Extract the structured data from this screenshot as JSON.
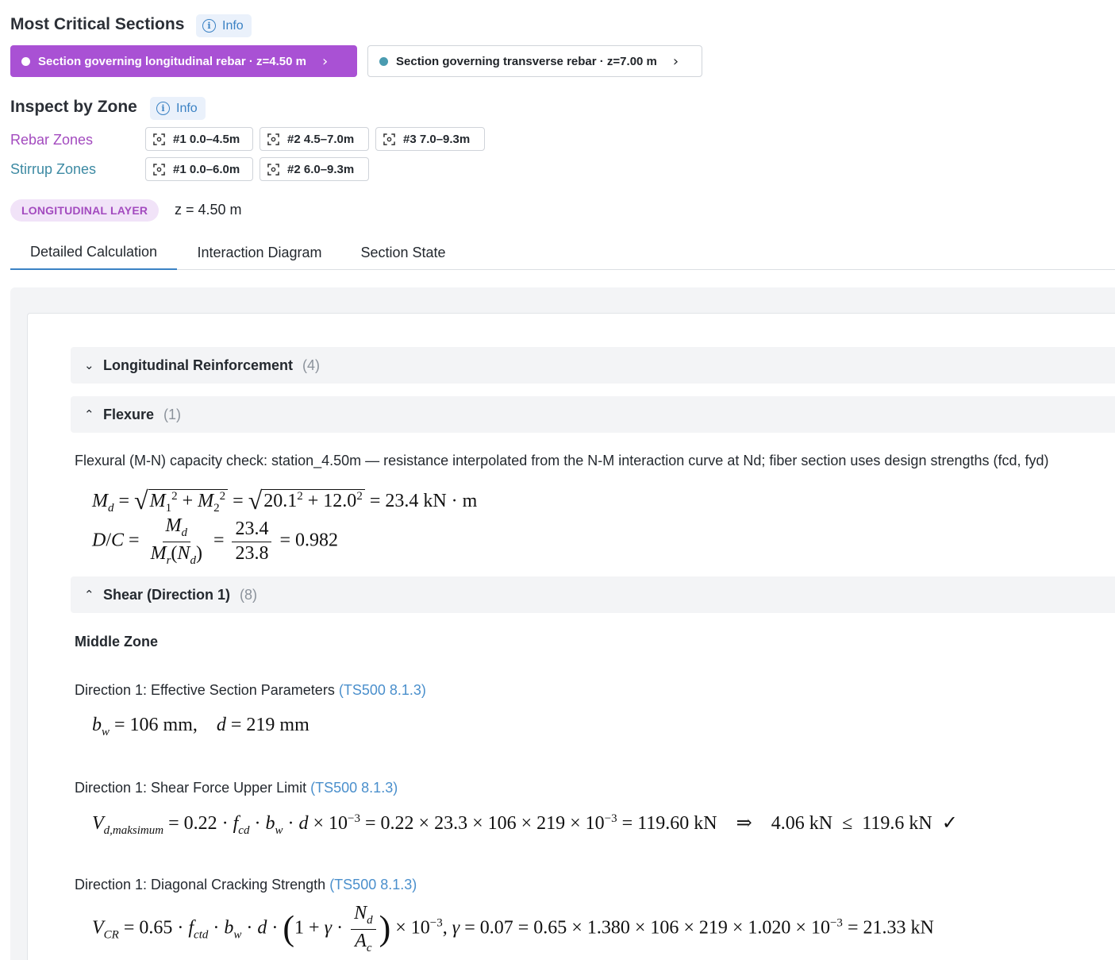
{
  "critical": {
    "title": "Most Critical Sections",
    "info_label": "Info",
    "buttons": [
      {
        "label": "Section governing longitudinal rebar · z=4.50 m",
        "active": true
      },
      {
        "label": "Section governing transverse rebar · z=7.00 m",
        "active": false
      }
    ]
  },
  "inspect": {
    "title": "Inspect by Zone",
    "info_label": "Info",
    "rebar_label": "Rebar Zones",
    "rebar_zones": [
      "#1 0.0–4.5m",
      "#2 4.5–7.0m",
      "#3 7.0–9.3m"
    ],
    "stirrup_label": "Stirrup Zones",
    "stirrup_zones": [
      "#1 0.0–6.0m",
      "#2 6.0–9.3m"
    ]
  },
  "layer": {
    "badge": "LONGITUDINAL LAYER",
    "z_text": "z = 4.50 m"
  },
  "tabs": [
    "Detailed Calculation",
    "Interaction Diagram",
    "Section State"
  ],
  "active_tab": 0,
  "sections": {
    "longitudinal": {
      "title": "Longitudinal Reinforcement",
      "count": "(4)"
    },
    "flexure": {
      "title": "Flexure",
      "count": "(1)",
      "desc": "Flexural (M-N) capacity check: station_4.50m — resistance interpolated from the N-M interaction curve at Nd; fiber section uses design strengths (fcd, fyd)"
    },
    "shear": {
      "title": "Shear (Direction 1)",
      "count": "(8)",
      "zone_title": "Middle Zone",
      "items": [
        {
          "label": "Direction 1: Effective Section Parameters",
          "ref": "(TS500 8.1.3)"
        },
        {
          "label": "Direction 1: Shear Force Upper Limit",
          "ref": "(TS500 8.1.3)"
        },
        {
          "label": "Direction 1: Diagonal Cracking Strength",
          "ref": "(TS500 8.1.3)"
        }
      ]
    }
  },
  "colors": {
    "accent_purple": "#a951d4",
    "stirrup_teal": "#3d8aa3",
    "info_blue": "#3b82c4",
    "panel_gray": "#f3f4f6"
  }
}
